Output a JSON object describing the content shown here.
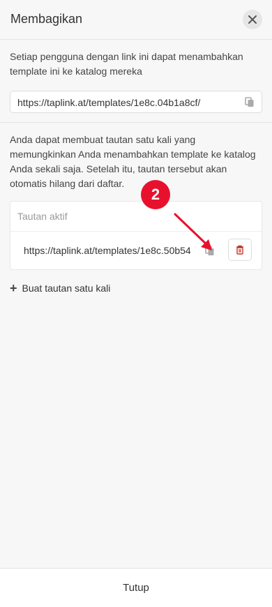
{
  "header": {
    "title": "Membagikan"
  },
  "share": {
    "description": "Setiap pengguna dengan link ini dapat menambahkan template ini ke katalog mereka",
    "link": "https://taplink.at/templates/1e8c.04b1a8cf/"
  },
  "one_time": {
    "description": "Anda dapat membuat tautan satu kali yang memungkinkan Anda menambahkan template ke katalog Anda sekali saja. Setelah itu, tautan tersebut akan otomatis hilang dari daftar.",
    "active_header": "Tautan aktif",
    "active_links": [
      "https://taplink.at/templates/1e8c.50b54"
    ],
    "create_label": "Buat tautan satu kali"
  },
  "annotation": {
    "badge": "2",
    "badge_color": "#e8112d"
  },
  "footer": {
    "close_label": "Tutup"
  }
}
